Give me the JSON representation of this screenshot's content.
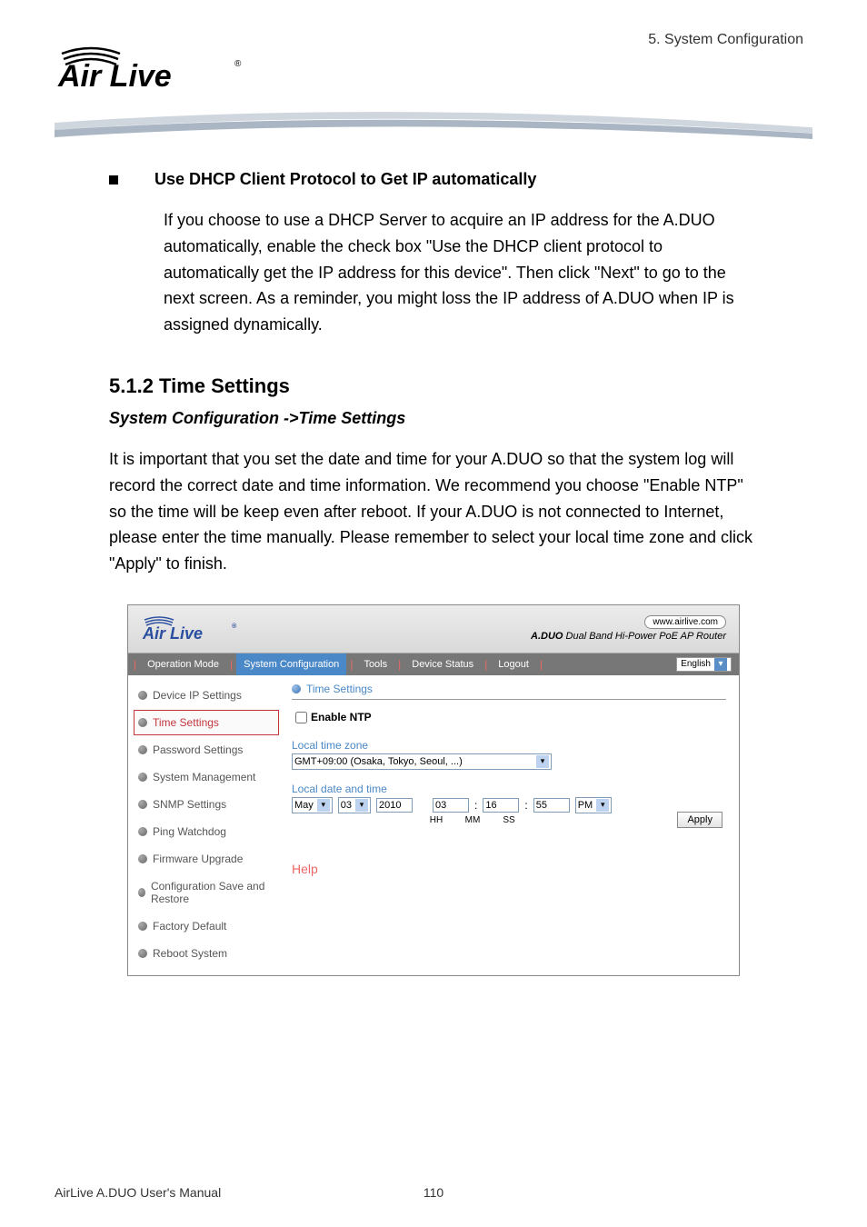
{
  "header": {
    "chapter": "5.  System  Configuration"
  },
  "bullet": {
    "title": " Use DHCP Client Protocol to Get IP automatically",
    "body": "If you choose to use a DHCP Server to acquire an IP address for the A.DUO automatically, enable the check box \"Use the DHCP client protocol to automatically get the IP address for this device\". Then click \"Next\" to go to the next screen. As a reminder, you might loss the IP address of A.DUO when IP is assigned dynamically."
  },
  "section": {
    "heading": "5.1.2 Time Settings",
    "sub": "System Configuration ->Time Settings",
    "para": "It is important that you set the date and time for your A.DUO so that the system log will record the correct date and time information. We recommend you choose \"Enable NTP\" so the time will be keep even after reboot. If your A.DUO is not connected to Internet, please enter the time manually. Please remember to select your local time zone and click \"Apply\" to finish."
  },
  "screenshot": {
    "top": {
      "site": "www.airlive.com",
      "product_prefix": "A.DUO",
      "product_rest": "   Dual Band Hi-Power PoE AP Router"
    },
    "nav": {
      "items": [
        "Operation Mode",
        "System Configuration",
        "Tools",
        "Device Status",
        "Logout"
      ],
      "active_index": 1,
      "lang": "English"
    },
    "sidebar": [
      "Device IP Settings",
      "Time Settings",
      "Password Settings",
      "System Management",
      "SNMP Settings",
      "Ping Watchdog",
      "Firmware Upgrade",
      "Configuration Save and Restore",
      "Factory Default",
      "Reboot System"
    ],
    "sidebar_active": 1,
    "main": {
      "title": "Time Settings",
      "enable_ntp": "Enable NTP",
      "tz_label": "Local time zone",
      "tz_value": "GMT+09:00 (Osaka, Tokyo, Seoul, ...)",
      "date_label": "Local date and time",
      "month": "May",
      "day": "03",
      "year": "2010",
      "hh": "03",
      "mm": "16",
      "ss": "55",
      "ampm": "PM",
      "col_hh": "HH",
      "col_mm": "MM",
      "col_ss": "SS",
      "apply": "Apply",
      "help": "Help"
    }
  },
  "footer": {
    "left": "AirLive A.DUO User's Manual",
    "page": "110"
  }
}
